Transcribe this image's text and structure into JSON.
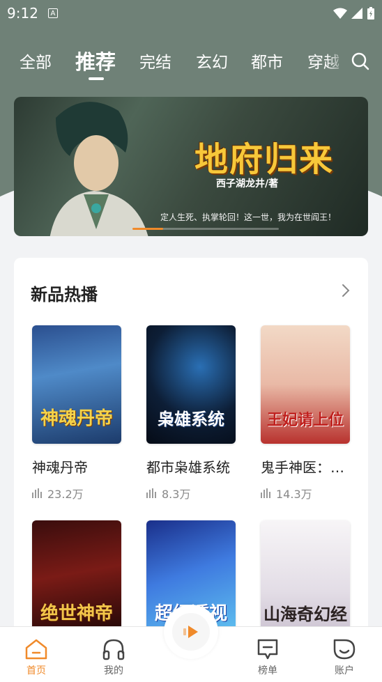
{
  "status": {
    "time": "9:12"
  },
  "tabs": [
    {
      "label": "全部"
    },
    {
      "label": "推荐"
    },
    {
      "label": "完结"
    },
    {
      "label": "玄幻"
    },
    {
      "label": "都市"
    },
    {
      "label": "穿越"
    }
  ],
  "banner": {
    "title": "地府归来",
    "author": "西子湖龙井/著",
    "slogan": "定人生死、执掌轮回！这一世，我为在世阎王！"
  },
  "section": {
    "title": "新品热播"
  },
  "books": [
    {
      "title": "神魂丹帝",
      "plays": "23.2万",
      "cover_text": "神魂丹帝"
    },
    {
      "title": "都市枭雄系统",
      "plays": "8.3万",
      "cover_text": "枭雄系统"
    },
    {
      "title": "鬼手神医：…",
      "plays": "14.3万",
      "cover_text": "王妃请上位"
    },
    {
      "title": "",
      "plays": "",
      "cover_text": "绝世神帝"
    },
    {
      "title": "",
      "plays": "",
      "cover_text": "超级透视"
    },
    {
      "title": "",
      "plays": "",
      "cover_text": "山海奇幻经"
    }
  ],
  "nav": [
    {
      "label": "首页"
    },
    {
      "label": "我的"
    },
    {
      "label": "榜单"
    },
    {
      "label": "账户"
    }
  ],
  "colors": {
    "accent": "#f08a2a",
    "header": "#6f8177"
  }
}
